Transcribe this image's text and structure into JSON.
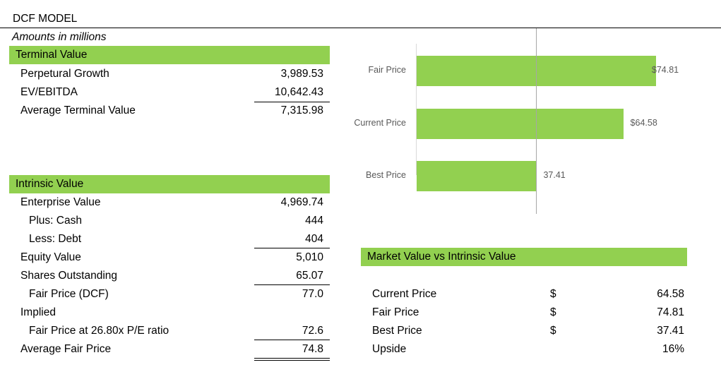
{
  "title": "DCF MODEL",
  "subtitle": "Amounts in millions",
  "terminal": {
    "header": "Terminal Value",
    "rows": [
      {
        "label": "Perpetural Growth",
        "value": "3,989.53"
      },
      {
        "label": "EV/EBITDA",
        "value": "10,642.43"
      },
      {
        "label": "Average Terminal Value",
        "value": "7,315.98"
      }
    ]
  },
  "intrinsic": {
    "header": "Intrinsic Value",
    "rows": [
      {
        "label": "Enterprise Value",
        "value": "4,969.74"
      },
      {
        "label": "Plus: Cash",
        "value": "444"
      },
      {
        "label": "Less: Debt",
        "value": "404"
      },
      {
        "label": "Equity Value",
        "value": "5,010"
      },
      {
        "label": "Shares Outstanding",
        "value": "65.07"
      },
      {
        "label": "Fair Price (DCF)",
        "value": "77.0"
      },
      {
        "label": "Implied",
        "value": ""
      },
      {
        "label": "Fair Price at  26.80x  P/E ratio",
        "value": "72.6"
      },
      {
        "label": "Average Fair Price",
        "value": "74.8"
      }
    ]
  },
  "market": {
    "header": "Market Value vs Intrinsic Value",
    "rows": [
      {
        "label": "Current Price",
        "currency": "$",
        "value": "64.58"
      },
      {
        "label": "Fair Price",
        "currency": "$",
        "value": "74.81"
      },
      {
        "label": "Best Price",
        "currency": "$",
        "value": "37.41"
      },
      {
        "label": "Upside",
        "currency": "",
        "value": "16%"
      }
    ]
  },
  "chart_data": {
    "type": "bar",
    "orientation": "horizontal",
    "categories": [
      "Fair Price",
      "Current Price",
      "Best Price"
    ],
    "values": [
      74.81,
      64.58,
      37.41
    ],
    "data_labels": [
      "$74.81",
      "$64.58",
      "37.41"
    ],
    "reference_line": 37.41,
    "xlim": [
      0,
      82
    ],
    "color": "#92d050"
  }
}
